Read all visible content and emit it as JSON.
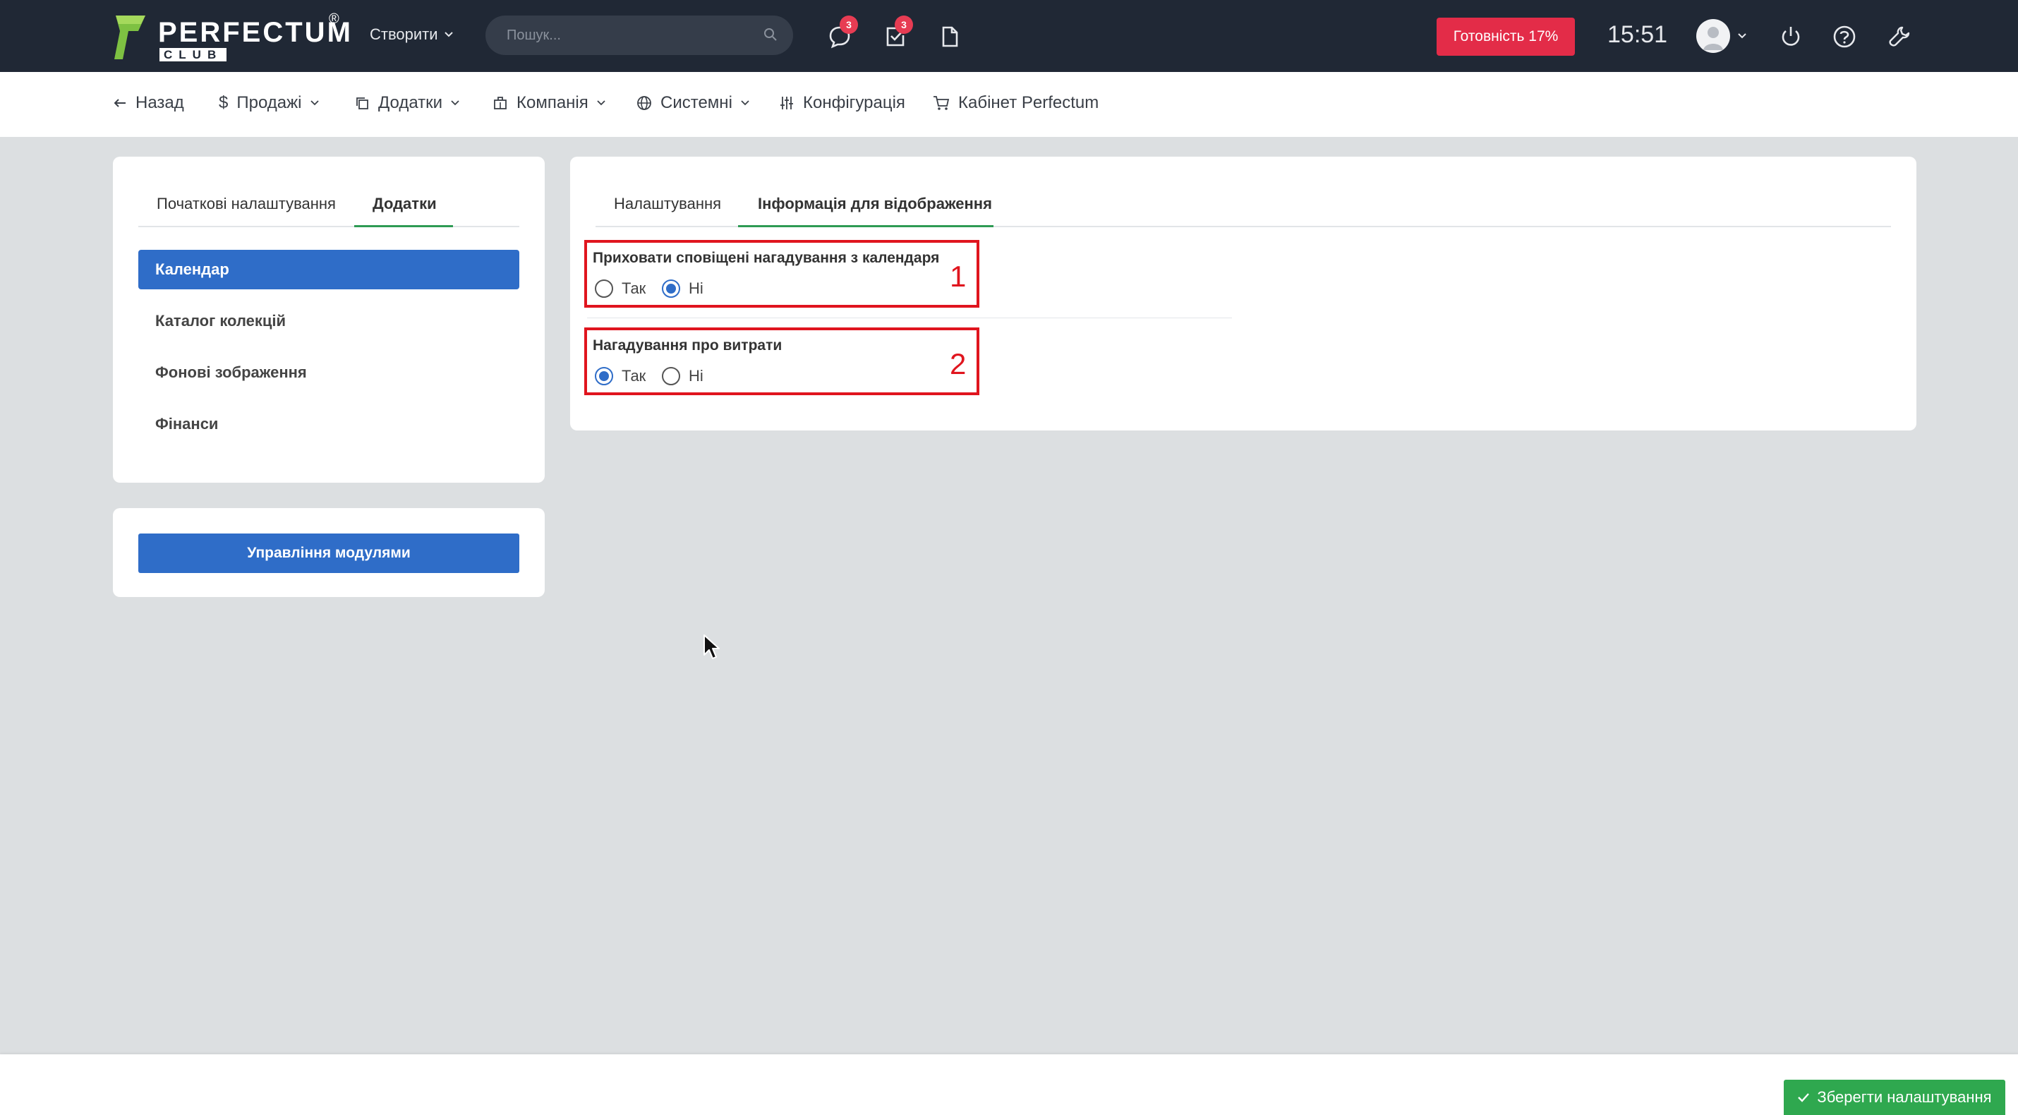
{
  "topbar": {
    "logo_text": "PERFECTUM",
    "logo_sub": "CLUB",
    "logo_reg": "®",
    "create_label": "Створити",
    "search_placeholder": "Пошук...",
    "messages_badge": "3",
    "tasks_badge": "3",
    "ready_label": "Готовність 17%",
    "time": "15:51"
  },
  "nav": {
    "back": "Назад",
    "sales": "Продажі",
    "addons": "Додатки",
    "company": "Компанія",
    "system": "Системні",
    "config": "Конфігурація",
    "cabinet": "Кабінет Perfectum"
  },
  "sidebar": {
    "tabs": [
      "Початкові налаштування",
      "Додатки"
    ],
    "active_tab": "Додатки",
    "items": [
      "Календар",
      "Каталог колекцій",
      "Фонові зображення",
      "Фінанси"
    ],
    "active_item": "Календар",
    "modules_button": "Управління модулями"
  },
  "main": {
    "tabs": [
      "Налаштування",
      "Інформація для відображення"
    ],
    "active_tab": "Інформація для відображення",
    "options": [
      {
        "title": "Приховати сповіщені нагадування з календаря",
        "yes": "Так",
        "no": "Ні",
        "selected": "Ні",
        "marker": "1"
      },
      {
        "title": "Нагадування про витрати",
        "yes": "Так",
        "no": "Ні",
        "selected": "Так",
        "marker": "2"
      }
    ]
  },
  "footer": {
    "save_label": "Зберегти налаштування"
  },
  "colors": {
    "topbar": "#202835",
    "accent_blue": "#2f6dc8",
    "ready_red": "#e32c48",
    "save_green": "#2fa84f",
    "tab_green": "#2e9b54",
    "annotation_red": "#e0151e"
  }
}
